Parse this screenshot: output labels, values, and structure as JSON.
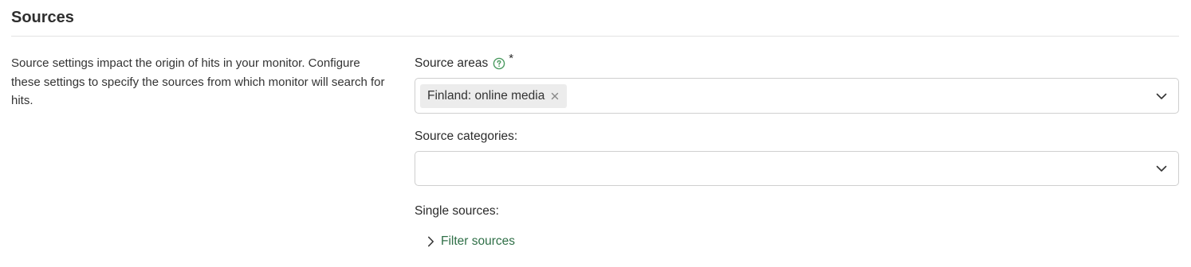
{
  "section": {
    "title": "Sources",
    "description": "Source settings impact the origin of hits in your monitor. Configure these settings to specify the sources from which monitor will search for hits."
  },
  "fields": {
    "source_areas": {
      "label": "Source areas",
      "required_mark": "*",
      "help_icon": "question-circle-icon",
      "selected": [
        "Finland: online media"
      ]
    },
    "source_categories": {
      "label": "Source categories:",
      "selected": []
    },
    "single_sources": {
      "label": "Single sources:",
      "filter_label": "Filter sources"
    }
  },
  "colors": {
    "accent_green": "#2f6f47",
    "help_icon_green": "#4a9a5f",
    "border": "#cfcfcf",
    "chip_bg": "#ececec"
  }
}
